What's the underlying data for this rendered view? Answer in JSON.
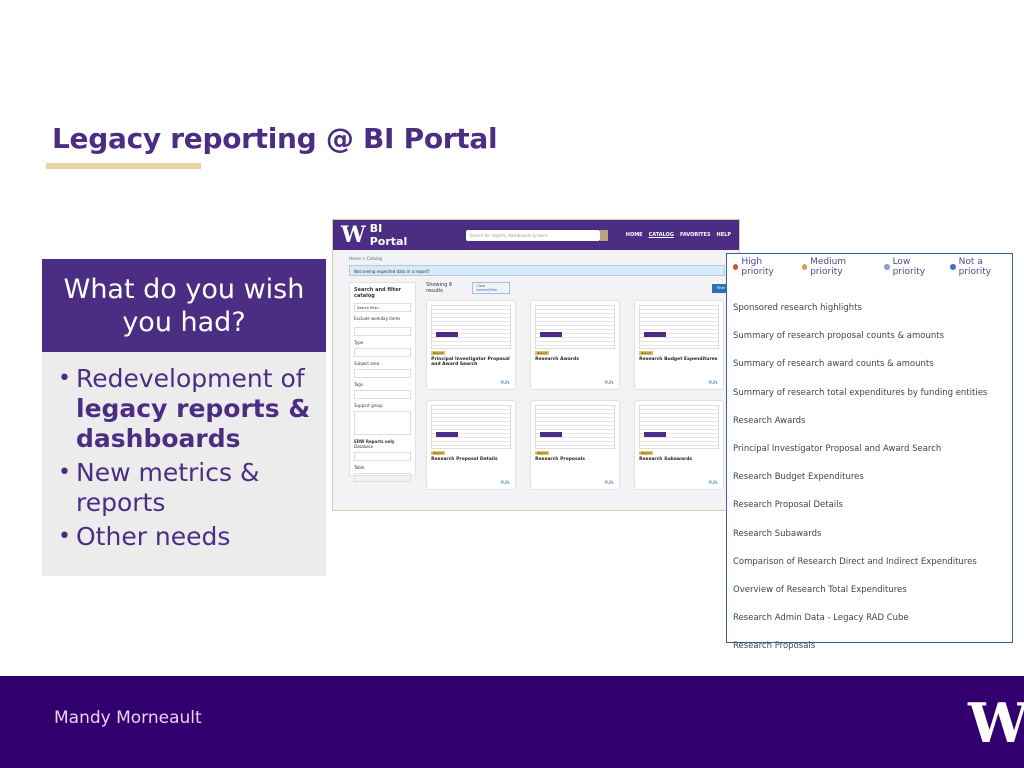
{
  "slide": {
    "title": "Legacy reporting @ BI Portal",
    "author": "Mandy Morneault",
    "logo_text": "W"
  },
  "wish": {
    "heading": "What do you wish you had?",
    "items": [
      {
        "pre": "Redevelopment of ",
        "bold": "legacy reports & dashboards"
      },
      {
        "pre": "New metrics & reports",
        "bold": ""
      },
      {
        "pre": "Other needs",
        "bold": ""
      }
    ]
  },
  "portal": {
    "logo": "W",
    "brand": "BI Portal",
    "search_placeholder": "Search for reports, dashboards & more",
    "nav": [
      "HOME",
      "CATALOG",
      "FAVORITES",
      "HELP"
    ],
    "breadcrumb": "Home > Catalog",
    "alert": "Not seeing expected data in a report?",
    "filter": {
      "heading": "Search and filter catalog",
      "search_placeholder": "Search filter...",
      "fields": [
        "Exclude workday items",
        "Type",
        "Subject area",
        "Tags",
        "Support group",
        "EDW Reports only",
        "Database",
        "Table"
      ]
    },
    "showing": "Showing 6 results",
    "chip": "Clear search/filter",
    "filter_button": "Filter view",
    "cards": [
      {
        "tag": "Report",
        "name": "Principal Investigator Proposal and Award Search",
        "run": "RUN"
      },
      {
        "tag": "Report",
        "name": "Research Awards",
        "run": "RUN"
      },
      {
        "tag": "Report",
        "name": "Research Budget Expenditures",
        "run": "RUN"
      },
      {
        "tag": "Report",
        "name": "Research Proposal Details",
        "run": "RUN"
      },
      {
        "tag": "Report",
        "name": "Research Proposals",
        "run": "RUN"
      },
      {
        "tag": "Report",
        "name": "Research Subawards",
        "run": "RUN"
      }
    ]
  },
  "priority": {
    "legend": [
      {
        "label": "High priority",
        "color": "#d4542a"
      },
      {
        "label": "Medium priority",
        "color": "#e8935a"
      },
      {
        "label": "Low priority",
        "color": "#8b9fd8"
      },
      {
        "label": "Not a priority",
        "color": "#4a6fd1"
      }
    ],
    "items": [
      "Sponsored research highlights",
      "Summary of research proposal counts & amounts",
      "Summary of research award counts & amounts",
      "Summary of research total expenditures by funding entities",
      "Research Awards",
      "Principal Investigator Proposal and Award Search",
      "Research Budget Expenditures",
      "Research Proposal Details",
      "Research Subawards",
      "Comparison of Research Direct and Indirect Expenditures",
      "Overview of Research Total Expenditures",
      "Research Admin Data - Legacy RAD Cube",
      "Research Proposals"
    ]
  }
}
